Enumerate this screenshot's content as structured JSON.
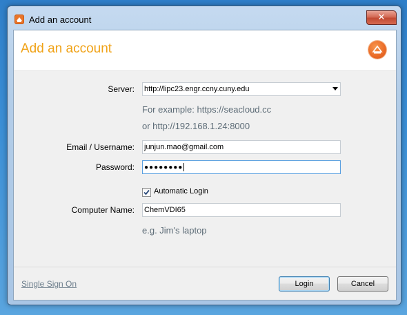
{
  "window": {
    "title": "Add an account",
    "close_glyph": "✕"
  },
  "header": {
    "title": "Add an account",
    "accent_color": "#f0a216",
    "logo_icon": "seafile-logo-icon"
  },
  "form": {
    "server": {
      "label": "Server:",
      "value": "http://lipc23.engr.ccny.cuny.edu",
      "hint_line1": "For example: https://seacloud.cc",
      "hint_line2": "or http://192.168.1.24:8000"
    },
    "email": {
      "label": "Email / Username:",
      "value": "junjun.mao@gmail.com"
    },
    "password": {
      "label": "Password:",
      "masked_value": "●●●●●●●●"
    },
    "automatic_login": {
      "label": "Automatic Login",
      "checked": true
    },
    "computer_name": {
      "label": "Computer Name:",
      "value": "ChemVDI65",
      "hint": "e.g. Jim's laptop"
    }
  },
  "footer": {
    "sso_link": "Single Sign On",
    "login_button": "Login",
    "cancel_button": "Cancel"
  }
}
